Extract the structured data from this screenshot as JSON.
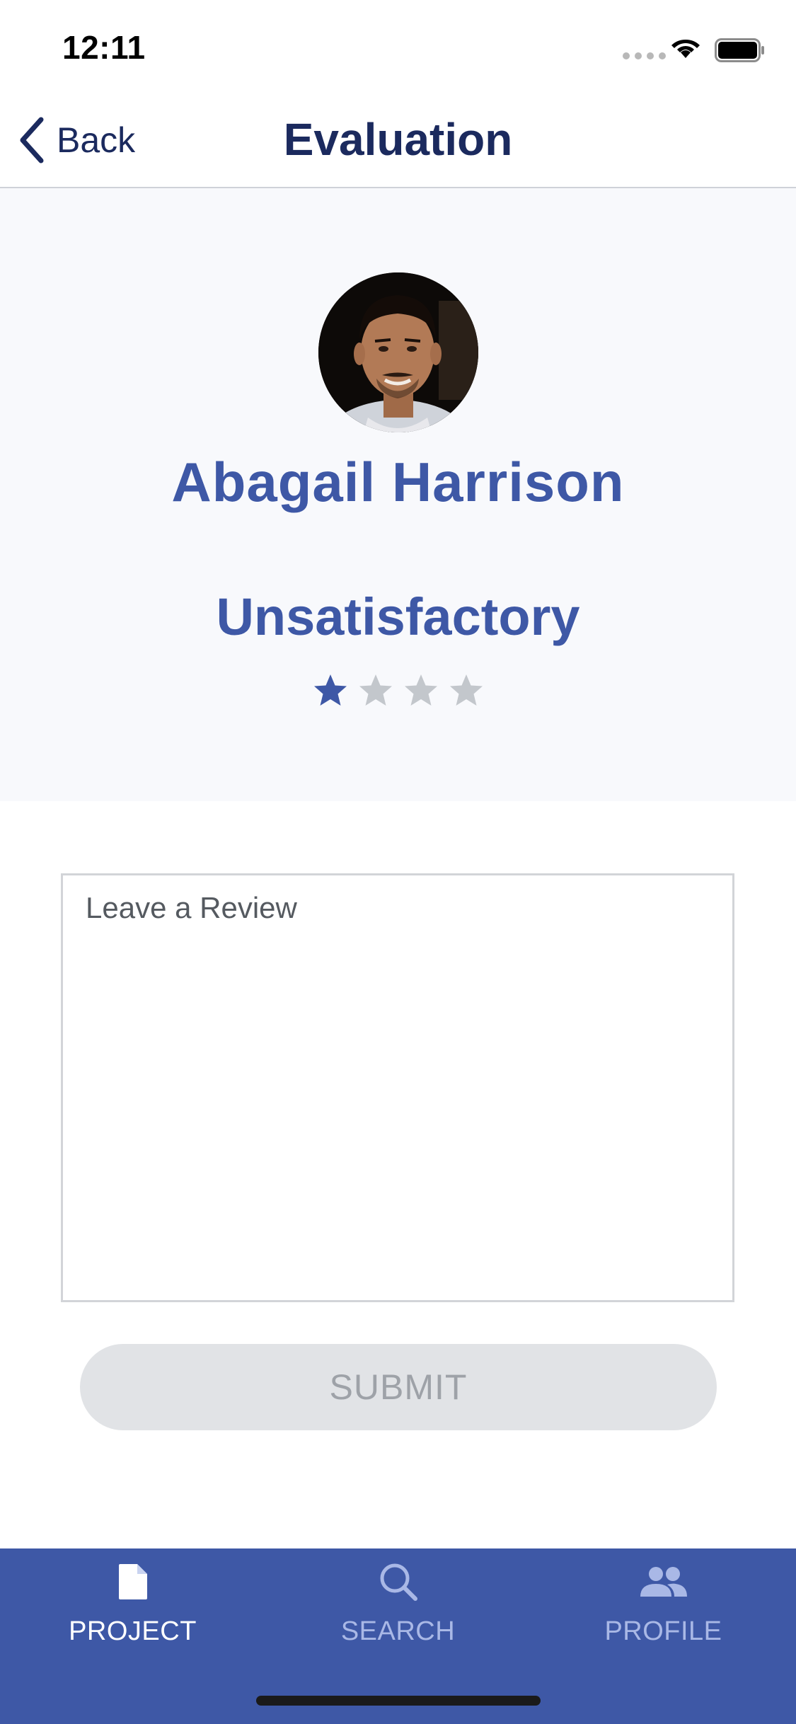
{
  "status_bar": {
    "time": "12:11"
  },
  "nav": {
    "back_label": "Back",
    "title": "Evaluation"
  },
  "profile": {
    "name": "Abagail Harrison",
    "rating_label": "Unsatisfactory",
    "rating": 1,
    "rating_max": 4
  },
  "review": {
    "placeholder": "Leave a Review",
    "value": ""
  },
  "submit_label": "SUBMIT",
  "tabs": [
    {
      "label": "PROJECT",
      "icon": "document-icon",
      "active": true
    },
    {
      "label": "SEARCH",
      "icon": "search-icon",
      "active": false
    },
    {
      "label": "PROFILE",
      "icon": "people-icon",
      "active": false
    }
  ],
  "colors": {
    "primary": "#3e58a6",
    "nav_text": "#1b2a5e",
    "star_active": "#3e58a6",
    "star_inactive": "#c3c7cc",
    "tab_inactive": "#a9b8e6"
  }
}
